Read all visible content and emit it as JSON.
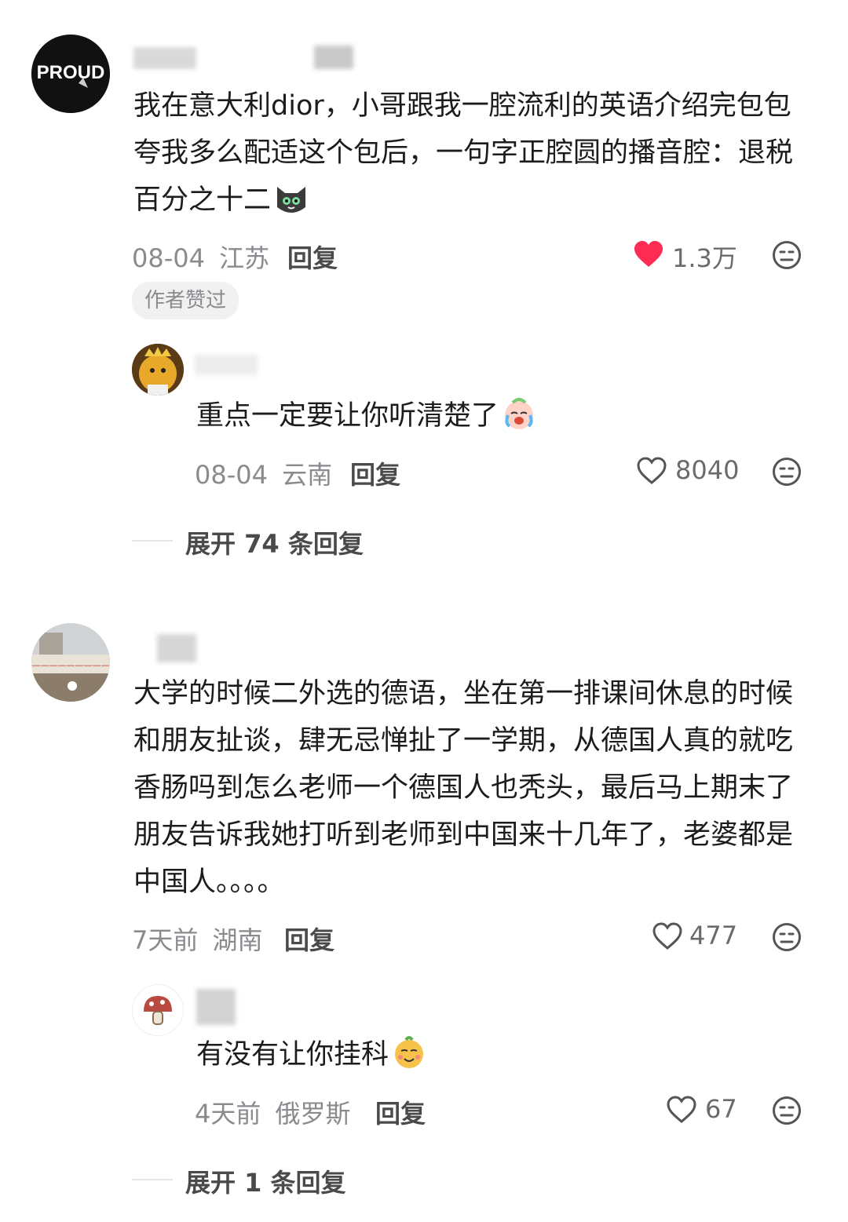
{
  "comments": [
    {
      "avatar_text": "PROUD",
      "text": "我在意大利dior，小哥跟我一腔流利的英语介绍完包包夸我多么配适这个包后，一句字正腔圆的播音腔：退税百分之十二",
      "date": "08-04",
      "location": "江苏",
      "reply_label": "回复",
      "likes": "1.3万",
      "liked": true,
      "badge": "作者赞过",
      "reply": {
        "text": "重点一定要让你听清楚了",
        "date": "08-04",
        "location": "云南",
        "reply_label": "回复",
        "likes": "8040"
      },
      "expand_label": "展开 74 条回复"
    },
    {
      "text": "大学的时候二外选的德语，坐在第一排课间休息的时候和朋友扯谈，肆无忌惮扯了一学期，从德国人真的就吃香肠吗到怎么老师一个德国人也秃头，最后马上期末了朋友告诉我她打听到老师到中国来十几年了，老婆都是中国人。。。。",
      "date": "7天前",
      "location": "湖南",
      "reply_label": "回复",
      "likes": "477",
      "liked": false,
      "reply": {
        "text": "有没有让你挂科",
        "date": "4天前",
        "location": "俄罗斯",
        "reply_label": "回复",
        "likes": "67"
      },
      "expand_label": "展开 1 条回复"
    }
  ],
  "colors": {
    "like_active": "#fe2c55",
    "meta_gray": "#8a8a8f"
  },
  "icons": [
    "heart-filled-icon",
    "heart-outline-icon",
    "dislike-face-icon",
    "cat-emoji-icon",
    "crying-emoji-icon",
    "smirk-emoji-icon"
  ]
}
